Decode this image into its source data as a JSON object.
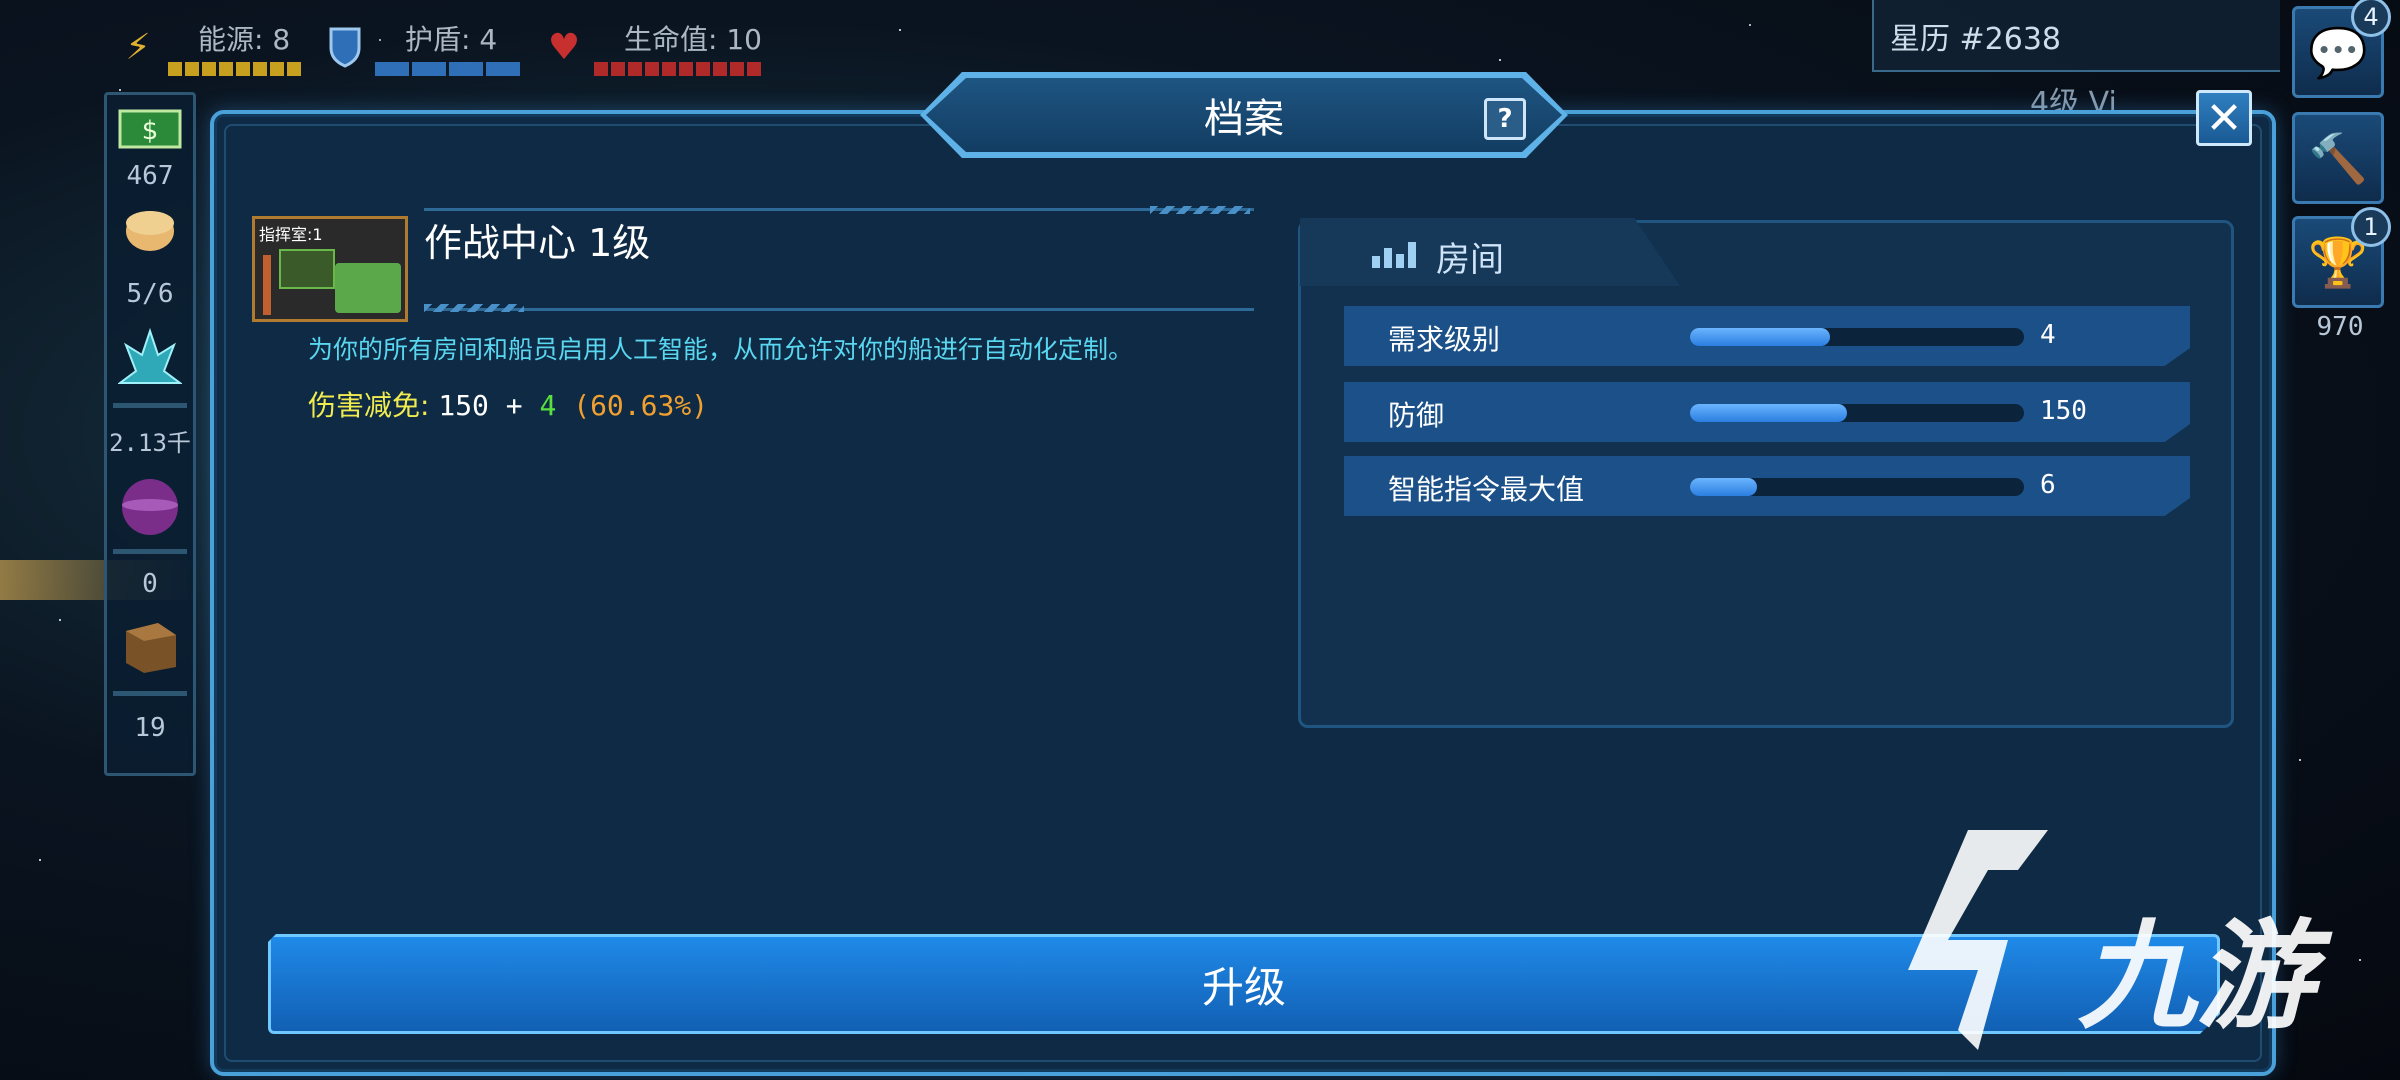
{
  "hud": {
    "energy_label": "能源: 8",
    "shield_label": "护盾: 4",
    "hp_label": "生命值: 10",
    "energy_icon": "lightning-icon",
    "shield_icon": "shield-icon",
    "hp_icon": "heart-icon",
    "colors": {
      "energy": "#c8a020",
      "shield": "#2f6fb8",
      "hp": "#b02a2a"
    }
  },
  "stardate": "星历 #2638",
  "level_tag": "4级 Vi",
  "sidebar": {
    "money": "467",
    "crew": "5/6",
    "minerals": "2.13千",
    "gas": "0",
    "cargo": "19"
  },
  "right_buttons": {
    "chat_badge": "4",
    "trophy_badge": "1",
    "trophy_count": "970"
  },
  "dialog": {
    "title": "档案",
    "help": "?",
    "close": "✕"
  },
  "room": {
    "thumb_label": "指挥室:1",
    "name": "作战中心 1级",
    "description": "为你的所有房间和船员启用人工智能，从而允许对你的船进行自动化定制。",
    "damage_label": "伤害减免: ",
    "damage_base": "150 + ",
    "damage_bonus": "4",
    "damage_pct": " (60.63%)"
  },
  "panel": {
    "title": "房间",
    "stats": [
      {
        "label": "需求级别",
        "value": "4",
        "fill": 0.42
      },
      {
        "label": "防御",
        "value": "150",
        "fill": 0.47
      },
      {
        "label": "智能指令最大值",
        "value": "6",
        "fill": 0.2
      }
    ]
  },
  "upgrade_button": "升级",
  "watermark": "九游"
}
